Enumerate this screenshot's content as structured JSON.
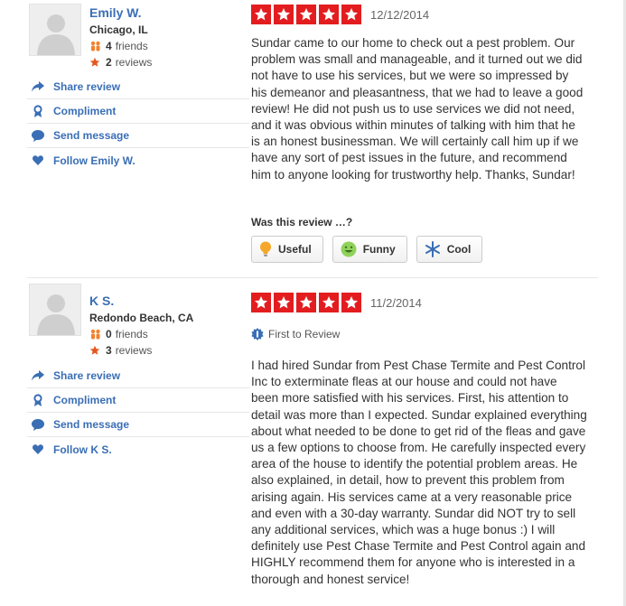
{
  "reviews": [
    {
      "user": {
        "name": "Emily W.",
        "location": "Chicago, IL",
        "friends": "4",
        "friends_label": "friends",
        "reviews": "2",
        "reviews_label": "reviews"
      },
      "actions": {
        "share": "Share review",
        "compliment": "Compliment",
        "message": "Send message",
        "follow": "Follow Emily W."
      },
      "rating_stars": 5,
      "date": "12/12/2014",
      "text": "Sundar came to our home to check out a pest problem. Our problem was small and manageable, and it turned out we did not have to use his services, but we were so impressed by his demeanor and pleasantness, that we had to leave a good review! He did not push us to use services we did not need, and it was obvious within minutes of talking with him that he is an honest businessman. We will certainly call him up if we have any sort of pest issues in the future, and recommend him to anyone looking for trustworthy help. Thanks, Sundar!",
      "was_this_review": "Was this review …?",
      "votes": {
        "useful": "Useful",
        "funny": "Funny",
        "cool": "Cool"
      }
    },
    {
      "user": {
        "name": "K S.",
        "location": "Redondo Beach, CA",
        "friends": "0",
        "friends_label": "friends",
        "reviews": "3",
        "reviews_label": "reviews"
      },
      "actions": {
        "share": "Share review",
        "compliment": "Compliment",
        "message": "Send message",
        "follow": "Follow K S."
      },
      "rating_stars": 5,
      "date": "11/2/2014",
      "badge": "First to Review",
      "text": "I had hired Sundar from Pest Chase Termite and Pest Control Inc to exterminate fleas at our house and could not have been more satisfied with his services.  First, his attention to detail was more than I expected.  Sundar explained everything about what needed to be done to get rid of the fleas and gave us a few options to choose from.  He carefully inspected every area of the house to identify the potential problem areas.  He also explained, in detail, how to prevent this problem from arising again. His services came at a very reasonable price and even with a 30-day warranty.  Sundar did NOT try to sell any additional services, which was a huge bonus :)  I will definitely use Pest Chase Termite and Pest Control again and HIGHLY recommend them for anyone who is interested in a thorough and honest service!"
    }
  ],
  "colors": {
    "star_red": "#e31d1f",
    "link_blue": "#3a6eb5",
    "friends_orange": "#f1822f",
    "badge_blue": "#3a6eb5"
  }
}
